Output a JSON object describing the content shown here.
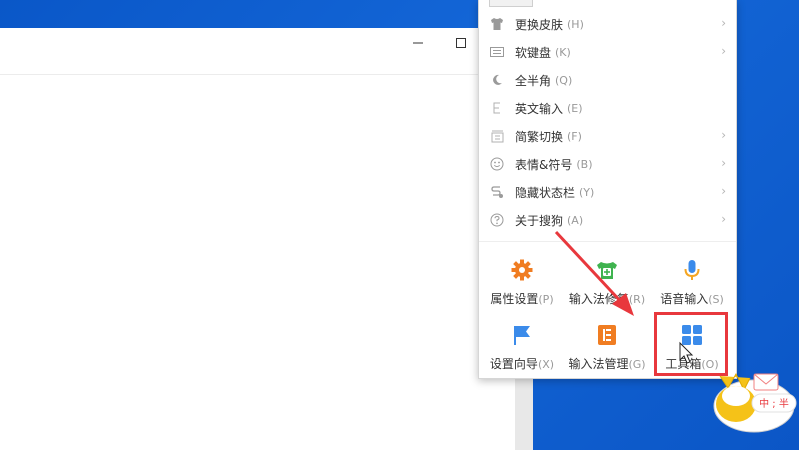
{
  "window": {
    "minimize_icon": "minimize-icon",
    "maximize_icon": "maximize-icon"
  },
  "menu": {
    "items": [
      {
        "icon": "shirt-icon",
        "label": "更换皮肤",
        "key": "(H)",
        "has_submenu": true
      },
      {
        "icon": "keyboard-icon",
        "label": "软键盘",
        "key": "(K)",
        "has_submenu": true
      },
      {
        "icon": "moon-icon",
        "label": "全半角",
        "key": "(Q)",
        "has_submenu": false
      },
      {
        "icon": "letter-e-icon",
        "label": "英文输入",
        "key": "(E)",
        "has_submenu": false
      },
      {
        "icon": "simplified-traditional-icon",
        "label": "简繁切换",
        "key": "(F)",
        "has_submenu": true
      },
      {
        "icon": "smiley-icon",
        "label": "表情&符号",
        "key": "(B)",
        "has_submenu": true
      },
      {
        "icon": "hide-statusbar-icon",
        "label": "隐藏状态栏",
        "key": "(Y)",
        "has_submenu": true
      },
      {
        "icon": "question-icon",
        "label": "关于搜狗",
        "key": "(A)",
        "has_submenu": true
      }
    ],
    "tools": [
      {
        "icon": "gear-icon",
        "label": "属性设置",
        "key": "(P)",
        "color": "#f07d22"
      },
      {
        "icon": "skin-plus-icon",
        "label": "输入法修复",
        "key": "(R)",
        "color": "#3fb34f"
      },
      {
        "icon": "microphone-icon",
        "label": "语音输入",
        "key": "(S)",
        "color": "#3b8bea"
      },
      {
        "icon": "flag-icon",
        "label": "设置向导",
        "key": "(X)",
        "color": "#3b8bea"
      },
      {
        "icon": "manager-icon",
        "label": "输入法管理",
        "key": "(G)",
        "color": "#f07d22"
      },
      {
        "icon": "toolbox-icon",
        "label": "工具箱",
        "key": "(O)",
        "color": "#3b8bea"
      }
    ]
  },
  "mascot": {
    "status_text": "中 ; 半"
  },
  "colors": {
    "highlight": "#e8383d",
    "desktop": "#0b5ccc"
  }
}
